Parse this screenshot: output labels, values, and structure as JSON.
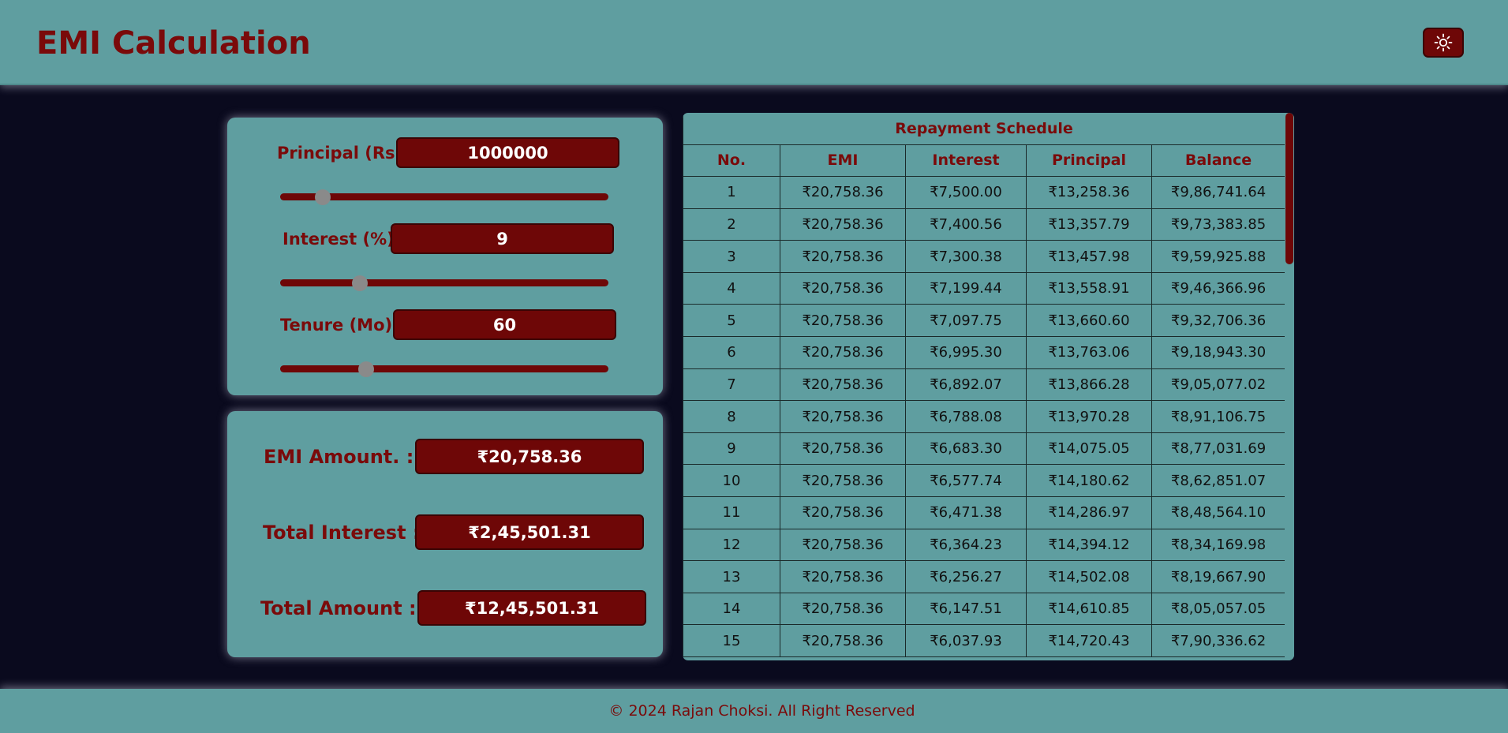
{
  "header": {
    "title": "EMI Calculation",
    "theme_icon": "sun-icon"
  },
  "inputs": {
    "principal": {
      "label": "Principal (Rs)",
      "value": "1000000",
      "slider_level": 0.11
    },
    "interest": {
      "label": "Interest (%)",
      "value": "9",
      "slider_level": 0.23
    },
    "tenure": {
      "label": "Tenure (Mo)",
      "value": "60",
      "slider_level": 0.25
    }
  },
  "results": {
    "emi": {
      "label": "EMI Amount. :",
      "value": "₹20,758.36"
    },
    "total_interest": {
      "label": "Total Interest :",
      "value": "₹2,45,501.31"
    },
    "total_amount": {
      "label": "Total Amount :",
      "value": "₹12,45,501.31"
    }
  },
  "schedule": {
    "title": "Repayment Schedule",
    "columns": [
      "No.",
      "EMI",
      "Interest",
      "Principal",
      "Balance"
    ],
    "rows": [
      [
        "1",
        "₹20,758.36",
        "₹7,500.00",
        "₹13,258.36",
        "₹9,86,741.64"
      ],
      [
        "2",
        "₹20,758.36",
        "₹7,400.56",
        "₹13,357.79",
        "₹9,73,383.85"
      ],
      [
        "3",
        "₹20,758.36",
        "₹7,300.38",
        "₹13,457.98",
        "₹9,59,925.88"
      ],
      [
        "4",
        "₹20,758.36",
        "₹7,199.44",
        "₹13,558.91",
        "₹9,46,366.96"
      ],
      [
        "5",
        "₹20,758.36",
        "₹7,097.75",
        "₹13,660.60",
        "₹9,32,706.36"
      ],
      [
        "6",
        "₹20,758.36",
        "₹6,995.30",
        "₹13,763.06",
        "₹9,18,943.30"
      ],
      [
        "7",
        "₹20,758.36",
        "₹6,892.07",
        "₹13,866.28",
        "₹9,05,077.02"
      ],
      [
        "8",
        "₹20,758.36",
        "₹6,788.08",
        "₹13,970.28",
        "₹8,91,106.75"
      ],
      [
        "9",
        "₹20,758.36",
        "₹6,683.30",
        "₹14,075.05",
        "₹8,77,031.69"
      ],
      [
        "10",
        "₹20,758.36",
        "₹6,577.74",
        "₹14,180.62",
        "₹8,62,851.07"
      ],
      [
        "11",
        "₹20,758.36",
        "₹6,471.38",
        "₹14,286.97",
        "₹8,48,564.10"
      ],
      [
        "12",
        "₹20,758.36",
        "₹6,364.23",
        "₹14,394.12",
        "₹8,34,169.98"
      ],
      [
        "13",
        "₹20,758.36",
        "₹6,256.27",
        "₹14,502.08",
        "₹8,19,667.90"
      ],
      [
        "14",
        "₹20,758.36",
        "₹6,147.51",
        "₹14,610.85",
        "₹8,05,057.05"
      ],
      [
        "15",
        "₹20,758.36",
        "₹6,037.93",
        "₹14,720.43",
        "₹7,90,336.62"
      ]
    ]
  },
  "footer": {
    "text": "© 2024 Rajan Choksi. All Right Reserved"
  },
  "colors": {
    "background": "#0a0a1e",
    "panel": "#5f9ea0",
    "accent": "#6e0707",
    "label_text": "#7a0a0a"
  }
}
